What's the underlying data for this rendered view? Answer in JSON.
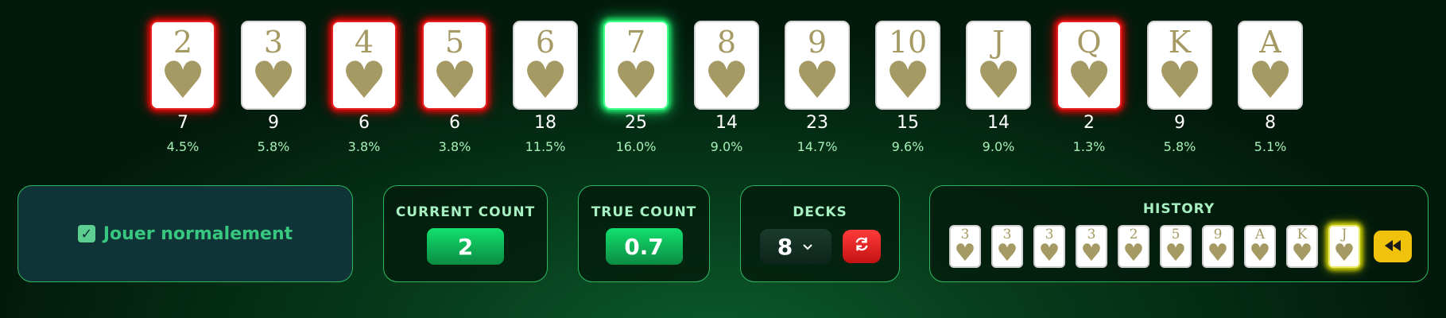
{
  "cards": [
    {
      "rank": "2",
      "count": "7",
      "pct": "4.5%",
      "state": "hot"
    },
    {
      "rank": "3",
      "count": "9",
      "pct": "5.8%",
      "state": ""
    },
    {
      "rank": "4",
      "count": "6",
      "pct": "3.8%",
      "state": "hot"
    },
    {
      "rank": "5",
      "count": "6",
      "pct": "3.8%",
      "state": "hot"
    },
    {
      "rank": "6",
      "count": "18",
      "pct": "11.5%",
      "state": ""
    },
    {
      "rank": "7",
      "count": "25",
      "pct": "16.0%",
      "state": "good"
    },
    {
      "rank": "8",
      "count": "14",
      "pct": "9.0%",
      "state": ""
    },
    {
      "rank": "9",
      "count": "23",
      "pct": "14.7%",
      "state": ""
    },
    {
      "rank": "10",
      "count": "15",
      "pct": "9.6%",
      "state": ""
    },
    {
      "rank": "J",
      "count": "14",
      "pct": "9.0%",
      "state": ""
    },
    {
      "rank": "Q",
      "count": "2",
      "pct": "1.3%",
      "state": "hot"
    },
    {
      "rank": "K",
      "count": "9",
      "pct": "5.8%",
      "state": ""
    },
    {
      "rank": "A",
      "count": "8",
      "pct": "5.1%",
      "state": ""
    }
  ],
  "suit_symbol": "♥",
  "play": {
    "label": "Jouer normalement",
    "checked": true
  },
  "current_count": {
    "title": "CURRENT COUNT",
    "value": "2"
  },
  "true_count": {
    "title": "TRUE COUNT",
    "value": "0.7"
  },
  "decks": {
    "title": "DECKS",
    "value": "8"
  },
  "history": {
    "title": "HISTORY",
    "cards": [
      "3",
      "3",
      "3",
      "3",
      "2",
      "5",
      "9",
      "A",
      "K",
      "J"
    ]
  },
  "colors": {
    "hot": "#d00a0a",
    "good": "#1ee36a",
    "accent": "#12e06e",
    "card_ink": "#a59a63",
    "reset": "#e52020",
    "rewind": "#f0c20c"
  },
  "icons": {
    "checkbox": "check-icon",
    "chevron": "chevron-down-icon",
    "reset": "refresh-icon",
    "rewind": "rewind-icon",
    "suit": "heart-icon"
  }
}
